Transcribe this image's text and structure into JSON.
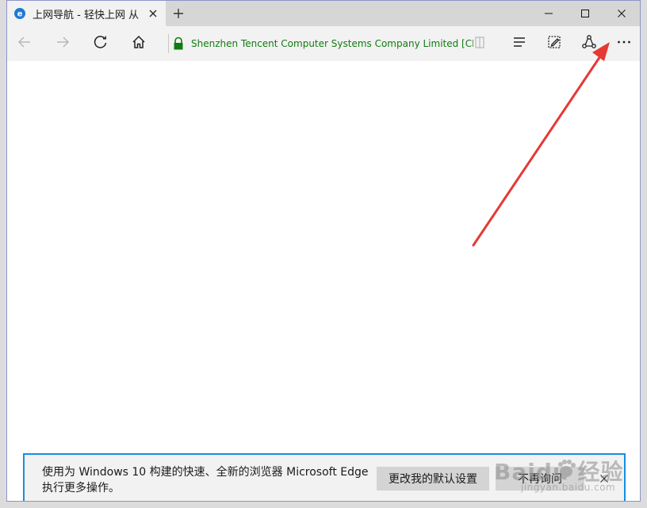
{
  "browser": {
    "tab": {
      "title": "上网导航 - 轻快上网 从",
      "favicon": "edge-e-icon"
    },
    "window_controls": {
      "minimize": "minimize-icon",
      "maximize": "maximize-icon",
      "close": "close-icon"
    },
    "address_bar": {
      "site_identity": "Shenzhen Tencent Computer Systems Company Limited [CN]",
      "security_color": "#107c10"
    },
    "toolbar_icons": [
      "back-arrow-icon",
      "forward-arrow-icon",
      "refresh-icon",
      "home-icon",
      "lock-icon",
      "reading-view-icon",
      "hub-icon",
      "web-note-icon",
      "share-icon",
      "more-icon"
    ]
  },
  "banner": {
    "message": "使用为 Windows 10 构建的快速、全新的浏览器 Microsoft Edge 执行更多操作。",
    "default_button": "更改我的默认设置",
    "no_ask_button": "不再询问",
    "accent_color": "#168ee0"
  },
  "watermark": {
    "brand": "Baidu 经验",
    "domain": "jingyan.baidu.com"
  },
  "annotation": {
    "color": "#e53935",
    "target": "more-icon"
  }
}
